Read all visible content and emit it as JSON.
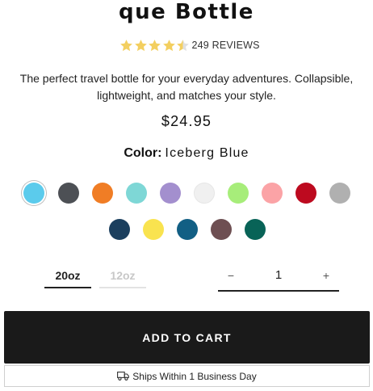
{
  "product": {
    "title": "que Bottle",
    "rating": 4.5,
    "reviews_label": "249 REVIEWS",
    "description": "The perfect travel bottle for your everyday adventures. Collapsible, lightweight, and matches your style.",
    "price": "$24.95"
  },
  "colors": {
    "label": "Color:",
    "selected": "Iceberg Blue",
    "swatches": [
      "#5bcbec",
      "#4d5055",
      "#f07d25",
      "#7ed7d6",
      "#a38fce",
      "#f0f0f0",
      "#a7ed7a",
      "#fba3a6",
      "#bd0a1f",
      "#b0b0b0",
      "#1b3f5e",
      "#f9e34f",
      "#125f84",
      "#6e4f52",
      "#086357"
    ]
  },
  "sizes": [
    {
      "label": "20oz",
      "active": true
    },
    {
      "label": "12oz",
      "active": false
    }
  ],
  "quantity": {
    "minus": "−",
    "value": "1",
    "plus": "+"
  },
  "cart": {
    "add_label": "ADD TO CART",
    "shipping_text": "Ships Within 1 Business Day",
    "shipping_icon": "truck-icon"
  },
  "theme": {
    "star_color": "#f3cf60",
    "star_empty": "#e0e0e0",
    "button_bg": "#1a1a1a"
  }
}
